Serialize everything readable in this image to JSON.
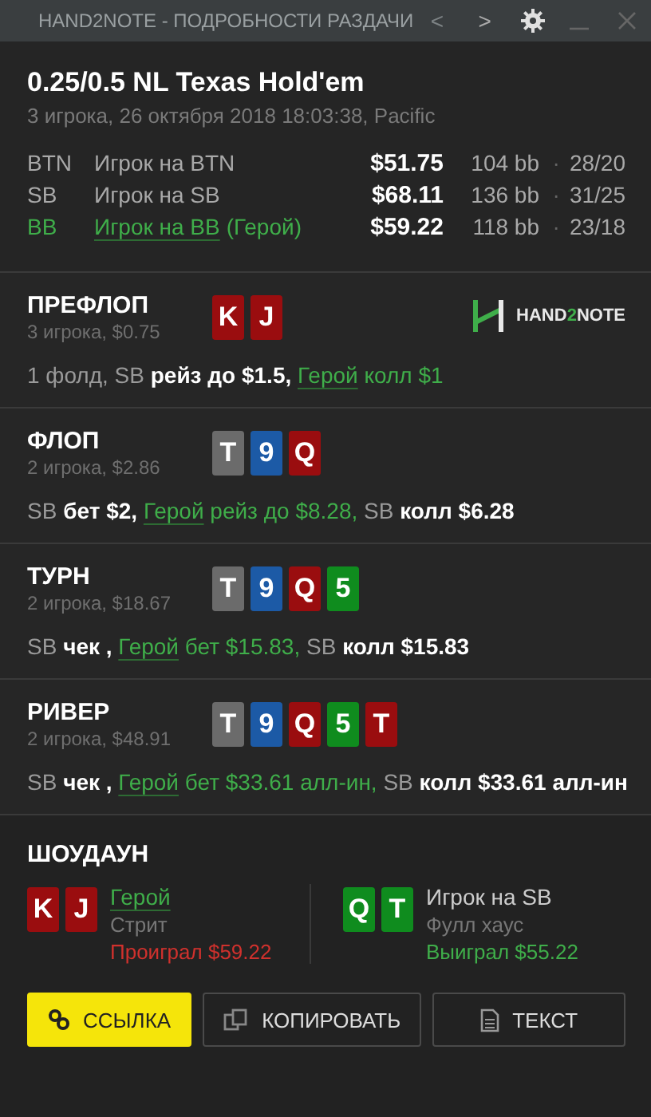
{
  "window": {
    "title": "HAND2NOTE - ПОДРОБНОСТИ РАЗДАЧИ",
    "controls": [
      "<",
      ">"
    ]
  },
  "header": {
    "title": "0.25/0.5 NL Texas Hold'em",
    "subtitle": "3 игрока, 26 октября 2018 18:03:38, Pacific",
    "players": [
      {
        "position": "BTN",
        "name": "Игрок на BTN",
        "hero": false,
        "stack": "$51.75",
        "bb": "104 bb",
        "sep": "·",
        "stats": "28/20"
      },
      {
        "position": "SB",
        "name": "Игрок на SB",
        "hero": false,
        "stack": "$68.11",
        "bb": "136 bb",
        "sep": "·",
        "stats": "31/25"
      },
      {
        "position": "BB",
        "name": "Игрок на BB",
        "hero": true,
        "hero_tag": "(Герой)",
        "stack": "$59.22",
        "bb": "118 bb",
        "sep": "·",
        "stats": "23/18"
      }
    ]
  },
  "logo": {
    "before": "HAND",
    "accent": "2",
    "after": "NOTE"
  },
  "streets": [
    {
      "name": "ПРЕФЛОП",
      "info": "3 игрока, $0.75",
      "cards": [
        {
          "rank": "K",
          "color": "#9a0d0f"
        },
        {
          "rank": "J",
          "color": "#9a0d0f"
        }
      ],
      "logo": true,
      "actions": [
        {
          "text": "1 фолд, SB",
          "kind": "muted"
        },
        {
          "text": "рейз до $1.5,",
          "kind": "action"
        },
        {
          "text": "Герой",
          "kind": "hero"
        },
        {
          "text": "колл $1",
          "kind": "hero_action"
        }
      ]
    },
    {
      "name": "ФЛОП",
      "info": "2 игрока, $2.86",
      "cards": [
        {
          "rank": "T",
          "color": "#6b6b6b"
        },
        {
          "rank": "9",
          "color": "#1c5aa6"
        },
        {
          "rank": "Q",
          "color": "#9a0d0f"
        }
      ],
      "logo": false,
      "actions": [
        {
          "text": "SB",
          "kind": "muted"
        },
        {
          "text": "бет $2,",
          "kind": "action"
        },
        {
          "text": "Герой",
          "kind": "hero"
        },
        {
          "text": "рейз до $8.28,",
          "kind": "hero_action"
        },
        {
          "text": "SB",
          "kind": "muted"
        },
        {
          "text": "колл $6.28",
          "kind": "action"
        }
      ]
    },
    {
      "name": "ТУРН",
      "info": "2 игрока, $18.67",
      "cards": [
        {
          "rank": "T",
          "color": "#6b6b6b"
        },
        {
          "rank": "9",
          "color": "#1c5aa6"
        },
        {
          "rank": "Q",
          "color": "#9a0d0f"
        },
        {
          "rank": "5",
          "color": "#0f8c1e"
        }
      ],
      "logo": false,
      "actions": [
        {
          "text": "SB",
          "kind": "muted"
        },
        {
          "text": "чек ,",
          "kind": "action"
        },
        {
          "text": "Герой",
          "kind": "hero"
        },
        {
          "text": "бет $15.83,",
          "kind": "hero_action"
        },
        {
          "text": "SB",
          "kind": "muted"
        },
        {
          "text": "колл $15.83",
          "kind": "action"
        }
      ]
    },
    {
      "name": "РИВЕР",
      "info": "2 игрока, $48.91",
      "cards": [
        {
          "rank": "T",
          "color": "#6b6b6b"
        },
        {
          "rank": "9",
          "color": "#1c5aa6"
        },
        {
          "rank": "Q",
          "color": "#9a0d0f"
        },
        {
          "rank": "5",
          "color": "#0f8c1e"
        },
        {
          "rank": "T",
          "color": "#9a0d0f"
        }
      ],
      "logo": false,
      "actions": [
        {
          "text": "SB",
          "kind": "muted"
        },
        {
          "text": "чек ,",
          "kind": "action"
        },
        {
          "text": "Герой",
          "kind": "hero"
        },
        {
          "text": "бет $33.61 алл-ин,",
          "kind": "hero_action"
        },
        {
          "text": "SB",
          "kind": "muted"
        },
        {
          "text": "колл $33.61 алл-ин",
          "kind": "action"
        }
      ]
    }
  ],
  "showdown": {
    "title": "ШОУДАУН",
    "players": [
      {
        "name": "Герой",
        "hero": true,
        "hand": "Стрит",
        "result": "Проиграл $59.22",
        "won": false,
        "cards": [
          {
            "rank": "K",
            "color": "#9a0d0f"
          },
          {
            "rank": "J",
            "color": "#9a0d0f"
          }
        ]
      },
      {
        "name": "Игрок на SB",
        "hero": false,
        "hand": "Фулл хаус",
        "result": "Выиграл $55.22",
        "won": true,
        "cards": [
          {
            "rank": "Q",
            "color": "#0f8c1e"
          },
          {
            "rank": "T",
            "color": "#0f8c1e"
          }
        ]
      }
    ]
  },
  "buttons": [
    {
      "label": "ССЫЛКА",
      "kind": "link",
      "primary": true
    },
    {
      "label": "КОПИРОВАТЬ",
      "kind": "copy",
      "primary": false
    },
    {
      "label": "ТЕКСТ",
      "kind": "text",
      "primary": false
    }
  ]
}
